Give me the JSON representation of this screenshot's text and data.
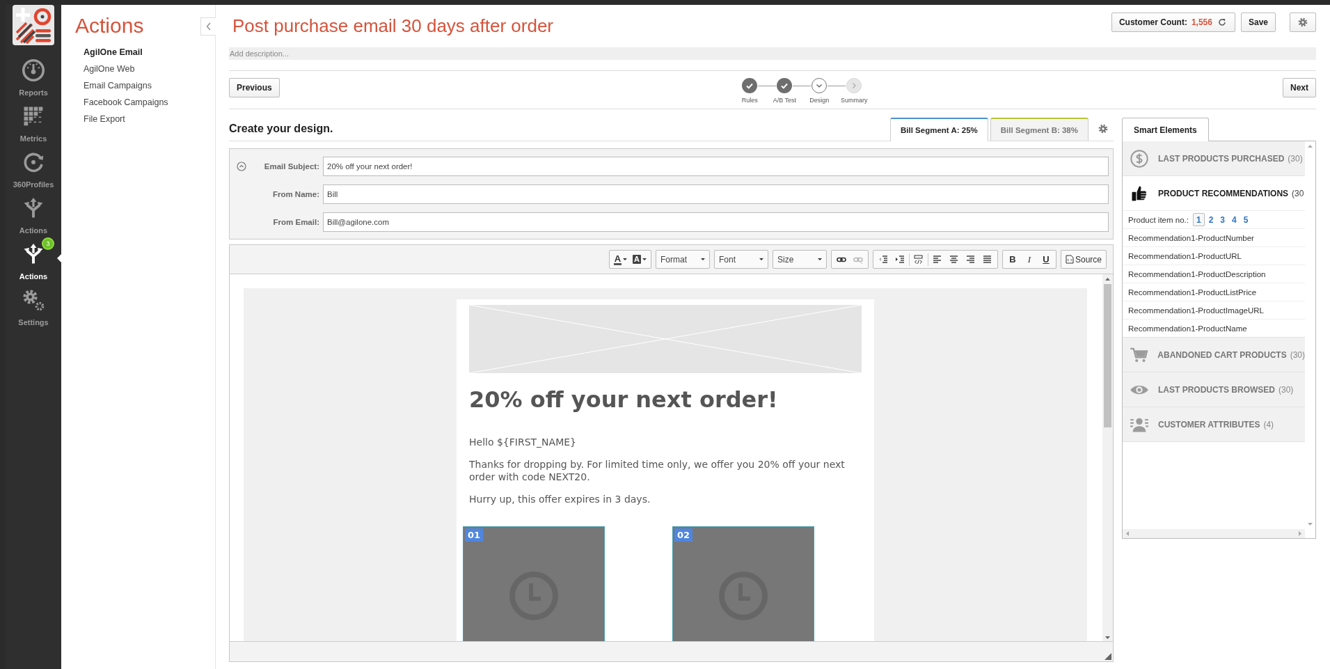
{
  "rail": {
    "items": [
      {
        "label": "Reports",
        "kind": "gauge",
        "selected": false
      },
      {
        "label": "Metrics",
        "kind": "grid",
        "selected": false
      },
      {
        "label": "360Profiles",
        "kind": "profile",
        "selected": false
      },
      {
        "label": "Actions",
        "kind": "fork",
        "selected": false
      },
      {
        "label": "Actions",
        "kind": "fork",
        "selected": true,
        "badge": "3"
      },
      {
        "label": "Settings",
        "kind": "gears",
        "selected": false
      }
    ]
  },
  "subnav": {
    "title": "Actions",
    "items": [
      {
        "label": "AgilOne Email",
        "selected": true
      },
      {
        "label": "AgilOne Web",
        "selected": false
      },
      {
        "label": "Email Campaigns",
        "selected": false
      },
      {
        "label": "Facebook Campaigns",
        "selected": false
      },
      {
        "label": "File Export",
        "selected": false
      }
    ]
  },
  "header": {
    "title": "Post purchase email 30 days after order",
    "description": {
      "placeholder": "Add description..."
    },
    "customer_count_label": "Customer Count:",
    "customer_count": "1,556",
    "save": "Save"
  },
  "wizard": {
    "previous": "Previous",
    "next": "Next",
    "steps": [
      {
        "label": "Rules",
        "done": true,
        "current": false
      },
      {
        "label": "A/B Test",
        "done": true,
        "current": false
      },
      {
        "label": "Design",
        "done": false,
        "current": true
      },
      {
        "label": "Summary",
        "done": false,
        "current": false
      }
    ]
  },
  "design": {
    "heading": "Create your design.",
    "segments": [
      {
        "label": "Bill Segment A: 25%",
        "selected": true,
        "color": "#4a90d0"
      },
      {
        "label": "Bill Segment B: 38%",
        "selected": false,
        "color": "#b8c43a"
      }
    ],
    "fields": [
      {
        "label": "Email Subject:",
        "value": "20% off your next order!"
      },
      {
        "label": "From Name:",
        "value": "Bill"
      },
      {
        "label": "From Email:",
        "value": "Bill@agilone.com"
      }
    ]
  },
  "editor": {
    "color_buttons": [
      {
        "label": "A",
        "kind": "text-color"
      },
      {
        "label": "A",
        "kind": "background-color"
      }
    ],
    "dropdowns": [
      "Format",
      "Font",
      "Size"
    ],
    "style_buttons": [
      {
        "label": "B",
        "kind": "bold"
      },
      {
        "label": "I",
        "kind": "italic"
      },
      {
        "label": "U",
        "kind": "underline"
      }
    ],
    "source": "Source",
    "email": {
      "heading": "20% off your next order!",
      "paragraphs": [
        "Hello ${FIRST_NAME}",
        "Thanks for dropping by. For limited time only, we offer you 20% off your next order with code NEXT20.",
        "Hurry up, this offer expires in 3 days."
      ],
      "products": [
        {
          "number": "01"
        },
        {
          "number": "02"
        }
      ]
    }
  },
  "smart": {
    "tab": "Smart Elements",
    "sections": [
      {
        "title": "LAST PRODUCTS PURCHASED",
        "count": "(30)",
        "kind": "dollar",
        "expanded": false
      },
      {
        "title": "PRODUCT RECOMMENDATIONS",
        "count": "(30",
        "kind": "thumb",
        "expanded": true,
        "item_label": "Product item no.:",
        "pages": [
          {
            "label": "1",
            "selected": true
          },
          {
            "label": "2",
            "selected": false
          },
          {
            "label": "3",
            "selected": false
          },
          {
            "label": "4",
            "selected": false
          },
          {
            "label": "5",
            "selected": false
          }
        ],
        "elements": [
          "Recommendation1-ProductNumber",
          "Recommendation1-ProductURL",
          "Recommendation1-ProductDescription",
          "Recommendation1-ProductListPrice",
          "Recommendation1-ProductImageURL",
          "Recommendation1-ProductName"
        ]
      },
      {
        "title": "ABANDONED CART PRODUCTS",
        "count": "(30)",
        "kind": "cart",
        "expanded": false
      },
      {
        "title": "LAST PRODUCTS BROWSED",
        "count": "(30)",
        "kind": "eye",
        "expanded": false
      },
      {
        "title": "CUSTOMER ATTRIBUTES",
        "count": "(4)",
        "kind": "person",
        "expanded": false
      }
    ]
  }
}
